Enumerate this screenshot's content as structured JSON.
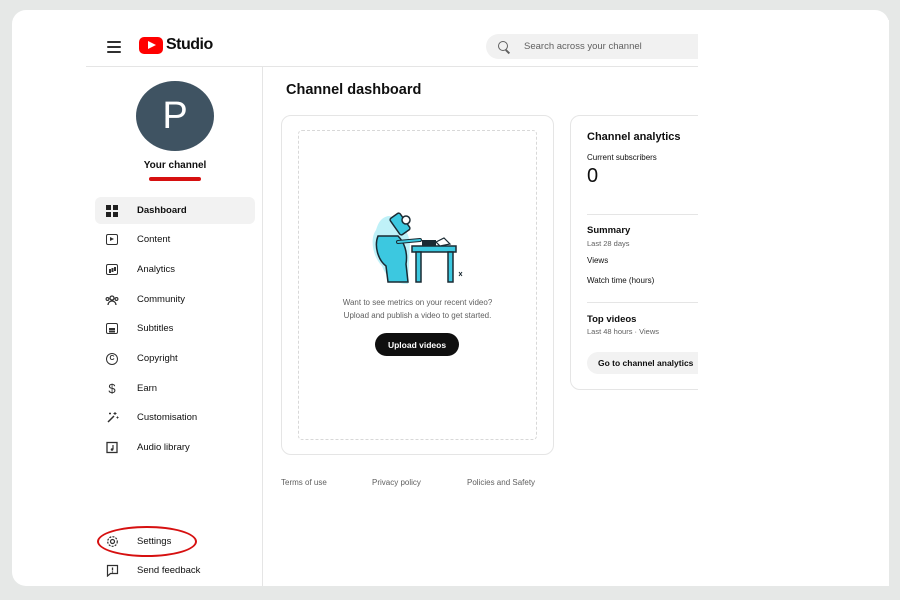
{
  "header": {
    "logo_text": "Studio",
    "search_placeholder": "Search across your channel"
  },
  "channel": {
    "avatar_letter": "P",
    "label": "Your channel"
  },
  "sidebar": {
    "items": [
      {
        "label": "Dashboard",
        "icon": "dashboard-icon",
        "active": true
      },
      {
        "label": "Content",
        "icon": "content-icon"
      },
      {
        "label": "Analytics",
        "icon": "analytics-icon"
      },
      {
        "label": "Community",
        "icon": "community-icon"
      },
      {
        "label": "Subtitles",
        "icon": "subtitles-icon"
      },
      {
        "label": "Copyright",
        "icon": "copyright-icon"
      },
      {
        "label": "Earn",
        "icon": "earn-icon"
      },
      {
        "label": "Customisation",
        "icon": "customisation-icon"
      },
      {
        "label": "Audio library",
        "icon": "audio-library-icon"
      }
    ],
    "settings": "Settings",
    "feedback": "Send feedback"
  },
  "main": {
    "title": "Channel dashboard",
    "upload": {
      "line1": "Want to see metrics on your recent video?",
      "line2": "Upload and publish a video to get started.",
      "button": "Upload videos"
    },
    "analytics": {
      "title": "Channel analytics",
      "subscribers_label": "Current subscribers",
      "subscribers_value": "0",
      "summary_title": "Summary",
      "summary_period": "Last 28 days",
      "views_label": "Views",
      "watch_time_label": "Watch time (hours)",
      "top_videos_title": "Top videos",
      "top_videos_period": "Last 48 hours · Views",
      "button": "Go to channel analytics"
    }
  },
  "footer": {
    "terms": "Terms of use",
    "privacy": "Privacy policy",
    "policies": "Policies and Safety"
  },
  "colors": {
    "accent_red": "#ff0000",
    "annotation_red": "#d61010",
    "avatar_bg": "#3f5362",
    "illustration_cyan": "#3cc8e0"
  }
}
